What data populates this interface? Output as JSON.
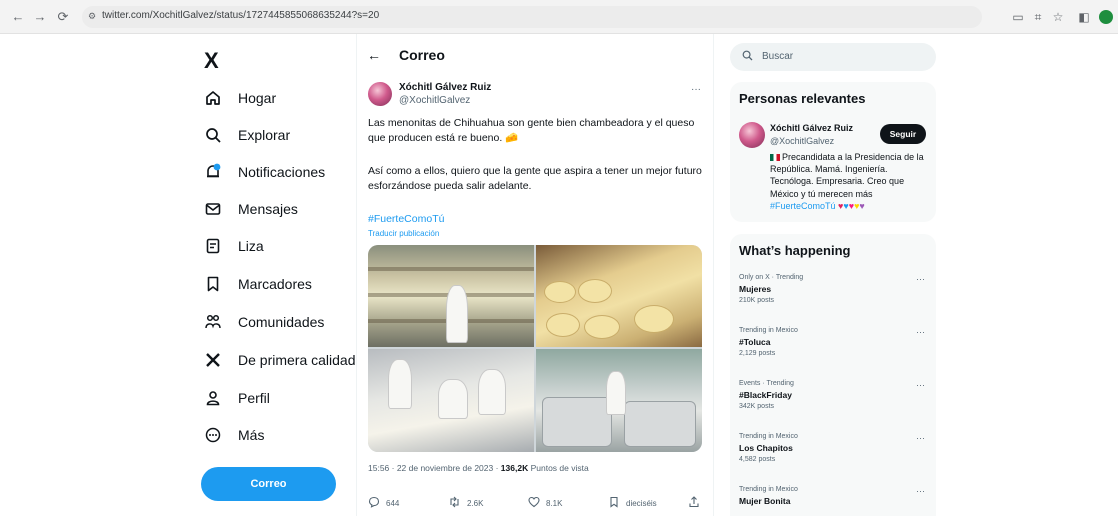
{
  "browser": {
    "url": "twitter.com/XochitlGalvez/status/1727445855068635244?s=20",
    "profile_color": "#1e8e3e"
  },
  "nav": {
    "logo": "X",
    "items": [
      {
        "label": "Hogar",
        "icon": "home-icon"
      },
      {
        "label": "Explorar",
        "icon": "search-icon"
      },
      {
        "label": "Notificaciones",
        "icon": "bell-icon"
      },
      {
        "label": "Mensajes",
        "icon": "mail-icon"
      },
      {
        "label": "Liza",
        "icon": "list-icon"
      },
      {
        "label": "Marcadores",
        "icon": "bookmark-icon"
      },
      {
        "label": "Comunidades",
        "icon": "communities-icon"
      },
      {
        "label": "De primera calidad",
        "icon": "x-premium-icon"
      },
      {
        "label": "Perfil",
        "icon": "person-icon"
      },
      {
        "label": "Más",
        "icon": "more-circle-icon"
      }
    ],
    "post_button": "Correo",
    "accent": "#1d9bf0"
  },
  "header": {
    "title": "Correo"
  },
  "tweet": {
    "author_name": "Xóchitl Gálvez Ruiz",
    "author_handle": "@XochitlGalvez",
    "more": "···",
    "text_p1": "Las menonitas de Chihuahua son gente bien chambeadora y el queso que producen está re bueno. 🧀",
    "text_p2": "Así como a ellos, quiero que la gente que aspira a tener un mejor futuro esforzándose pueda salir adelante.",
    "hashtag": "#FuerteComoTú",
    "translate": "Traducir publicación",
    "time": "15:56 · 22 de noviembre de 2023 · ",
    "views_count": "136,2K",
    "views_label": " Puntos de vista",
    "actions": {
      "reply": "644",
      "repost": "2.6K",
      "like": "8.1K",
      "bookmark": "dieciséis"
    }
  },
  "search": {
    "placeholder": "Buscar"
  },
  "relevant": {
    "title": "Personas relevantes",
    "name": "Xóchitl Gálvez Ruiz",
    "handle": "@XochitlGalvez",
    "follow": "Seguir",
    "bio": "Precandidata a la Presidencia de la República. Mamá. Ingeniería. Tecnóloga. Empresaria. Creo que México y tú merecen más ",
    "bio_link": "#FuerteComoTú"
  },
  "trending": {
    "title": "What’s happening",
    "items": [
      {
        "context": "Only on X · Trending",
        "name": "Mujeres",
        "count": "210K posts"
      },
      {
        "context": "Trending in Mexico",
        "name": "#Toluca",
        "count": "2,129 posts"
      },
      {
        "context": "Events · Trending",
        "name": "#BlackFriday",
        "count": "342K posts"
      },
      {
        "context": "Trending in Mexico",
        "name": "Los Chapitos",
        "count": "4,582 posts"
      },
      {
        "context": "Trending in Mexico",
        "name": "Mujer Bonita",
        "count": ""
      }
    ]
  }
}
